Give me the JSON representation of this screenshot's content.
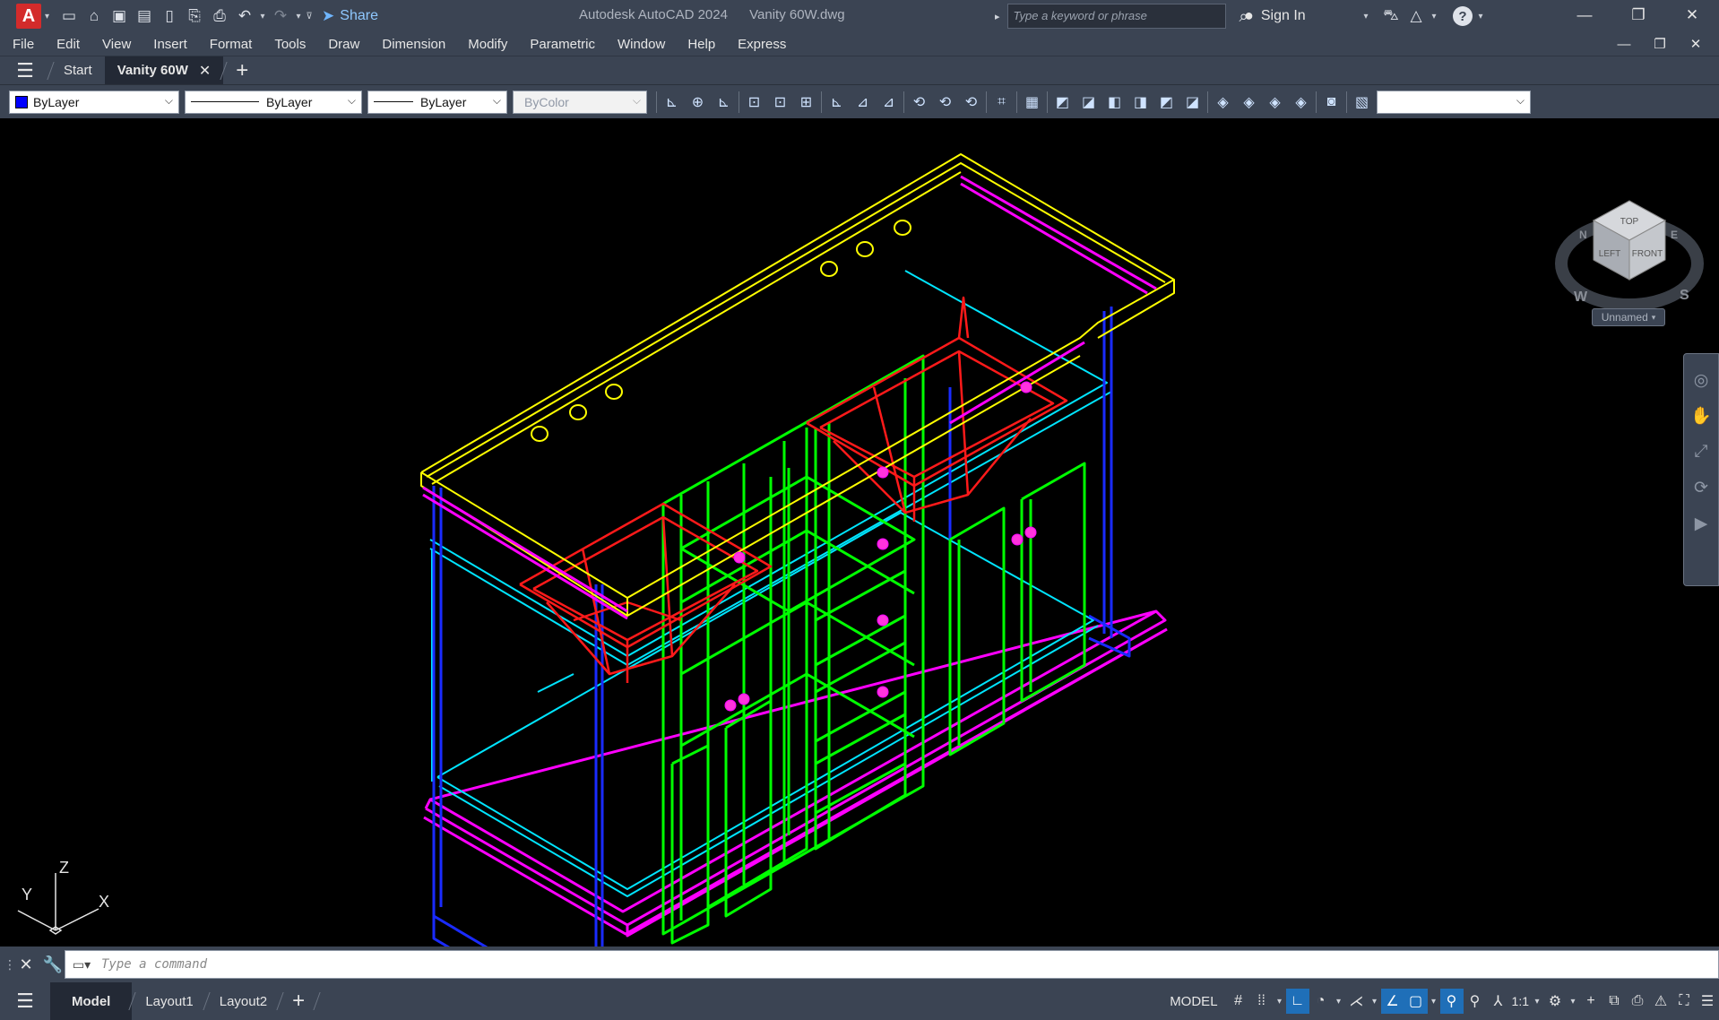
{
  "titlebar": {
    "app_logo": "A",
    "share_label": "Share",
    "app_name": "Autodesk AutoCAD 2024",
    "file_name": "Vanity 60W.dwg",
    "search_placeholder": "Type a keyword or phrase",
    "signin_label": "Sign In"
  },
  "menu": [
    "File",
    "Edit",
    "View",
    "Insert",
    "Format",
    "Tools",
    "Draw",
    "Dimension",
    "Modify",
    "Parametric",
    "Window",
    "Help",
    "Express"
  ],
  "tabs": {
    "start_label": "Start",
    "active_label": "Vanity 60W"
  },
  "properties": {
    "color": "ByLayer",
    "color_swatch": "#0000ff",
    "linetype": "ByLayer",
    "lineweight": "ByLayer",
    "plotstyle": "ByColor"
  },
  "viewcube": {
    "top": "TOP",
    "left": "LEFT",
    "front": "FRONT",
    "compass_w": "W",
    "compass_s": "S",
    "compass_n": "N",
    "compass_e": "E",
    "view_name": "Unnamed"
  },
  "ucs": {
    "x": "X",
    "y": "Y",
    "z": "Z"
  },
  "commandline": {
    "placeholder": "Type a command"
  },
  "statusbar": {
    "model_tab": "Model",
    "layout1": "Layout1",
    "layout2": "Layout2",
    "space_label": "MODEL",
    "annotation_scale": "1:1"
  },
  "colors": {
    "ui_background": "#3b4453",
    "countertop": "#ffff00",
    "sink": "#ff0000",
    "cabinet": "#00ff00",
    "frame": "#0000ff",
    "trim": "#00e5ff",
    "base": "#ff00ff"
  }
}
